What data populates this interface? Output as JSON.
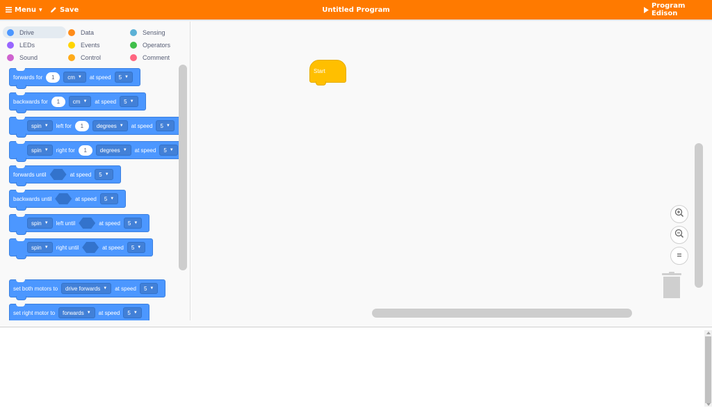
{
  "topbar": {
    "menu_label": "Menu",
    "save_label": "Save",
    "title": "Untitled Program",
    "program_label": "Program Edison",
    "color": "#ff7a00"
  },
  "categories": [
    {
      "label": "Drive",
      "color": "#4c97ff",
      "selected": true
    },
    {
      "label": "Data",
      "color": "#ff8c1a"
    },
    {
      "label": "Sensing",
      "color": "#5cb1d6"
    },
    {
      "label": "LEDs",
      "color": "#9966ff"
    },
    {
      "label": "Events",
      "color": "#ffd500"
    },
    {
      "label": "Operators",
      "color": "#40bf4a"
    },
    {
      "label": "Sound",
      "color": "#cf63cf"
    },
    {
      "label": "Control",
      "color": "#ffab19"
    },
    {
      "label": "Comment",
      "color": "#ff6680"
    }
  ],
  "blocks": {
    "b1": {
      "t1": "forwards for",
      "n": "1",
      "unit": "cm",
      "t2": "at speed",
      "speed": "5"
    },
    "b2": {
      "t1": "backwards for",
      "n": "1",
      "unit": "cm",
      "t2": "at speed",
      "speed": "5"
    },
    "b3": {
      "dir": "spin",
      "t1": "left for",
      "n": "1",
      "unit": "degrees",
      "t2": "at speed",
      "speed": "5"
    },
    "b4": {
      "dir": "spin",
      "t1": "right for",
      "n": "1",
      "unit": "degrees",
      "t2": "at speed",
      "speed": "5"
    },
    "b5": {
      "t1": "forwards until",
      "t2": "at speed",
      "speed": "5"
    },
    "b6": {
      "t1": "backwards until",
      "t2": "at speed",
      "speed": "5"
    },
    "b7": {
      "dir": "spin",
      "t1": "left until",
      "t2": "at speed",
      "speed": "5"
    },
    "b8": {
      "dir": "spin",
      "t1": "right until",
      "t2": "at speed",
      "speed": "5"
    },
    "b9": {
      "t1": "set both motors to",
      "mode": "drive forwards",
      "t2": "at speed",
      "speed": "5"
    },
    "b10": {
      "t1": "set right motor to",
      "mode": "forwards",
      "t2": "at speed",
      "speed": "5"
    }
  },
  "workspace": {
    "start_label": "Start"
  }
}
